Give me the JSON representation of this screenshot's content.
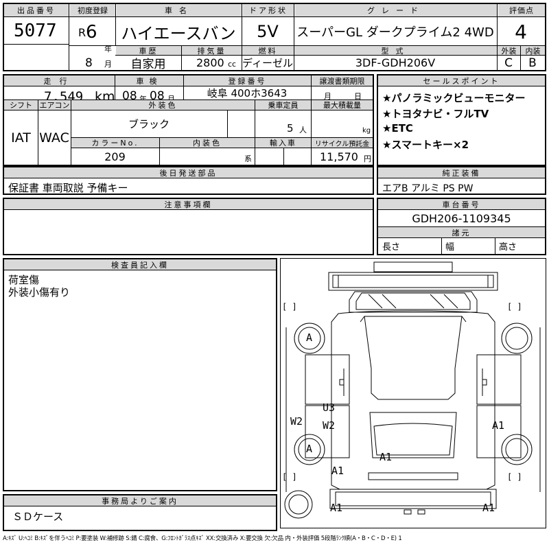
{
  "header": {
    "lot_label": "出品番号",
    "lot": "5077",
    "first_reg_label": "初度登録",
    "era": "R",
    "year": "6",
    "year_unit": "年",
    "month": "8",
    "month_unit": "月",
    "name_label": "車名",
    "name": "ハイエースバン",
    "door_label": "ドア形状",
    "door": "5V",
    "grade_label": "グレード",
    "grade": "スーパーGL ダークプライム2 4WD",
    "score_label": "評価点",
    "score": "4",
    "history_label": "車歴",
    "history": "自家用",
    "disp_label": "排気量",
    "disp": "2800",
    "disp_unit": "cc",
    "fuel_label": "燃料",
    "fuel": "ディーゼル",
    "model_label": "型式",
    "model": "3DF-GDH206V",
    "ext_label": "外装",
    "ext": "C",
    "int_label": "内装",
    "int": "B"
  },
  "details": {
    "mileage_label": "走行",
    "mileage": "7,549",
    "mileage_unit": "km",
    "inspect_label": "車検",
    "inspect_y": "08",
    "inspect_y_unit": "年",
    "inspect_m": "08",
    "inspect_m_unit": "月",
    "reg_label": "登録番号",
    "reg": "岐阜 400ホ3643",
    "transfer_label": "譲渡書類期限",
    "transfer_m_unit": "月",
    "transfer_d_unit": "日",
    "shift_label": "シフト",
    "shift": "IAT",
    "ac_label": "エアコン",
    "ac": "WAC",
    "color_label": "外装色",
    "color": "ブラック",
    "seats_label": "乗車定員",
    "seats": "5",
    "seats_unit": "人",
    "load_label": "最大積載量",
    "load_unit": "kg",
    "colorno_label": "カラーNo.",
    "colorno": "209",
    "intcolor_label": "内装色",
    "intcolor_unit": "系",
    "import_label": "輸入車",
    "recycle_label": "リサイクル預託金",
    "recycle": "11,570",
    "recycle_unit": "円"
  },
  "sales": {
    "label": "セールスポイント",
    "items": [
      "★パノラミックビューモニター",
      "★トヨタナビ・フルTV",
      "★ETC",
      "★スマートキー×2"
    ]
  },
  "later_parts": {
    "label": "後日発送部品",
    "value": "保証書 車両取説 予備キー"
  },
  "equipment": {
    "label": "純正装備",
    "value": "エアB アルミ PS PW"
  },
  "caution": {
    "label": "注意事項欄"
  },
  "chassis": {
    "label": "車台番号",
    "value": "GDH206-1109345"
  },
  "specs": {
    "label": "諸元",
    "length_label": "長さ",
    "width_label": "幅",
    "height_label": "高さ"
  },
  "inspector": {
    "label": "検査員記入欄",
    "lines": [
      "荷室傷",
      "外装小傷有り"
    ]
  },
  "office": {
    "label": "事務局よりご案内",
    "value": "ＳＤケース"
  },
  "diagram": {
    "bracket": "[   ]",
    "marks": {
      "wheel_fl": "A",
      "wheel_rl": "A",
      "u3": "U3",
      "w2_left": "W2",
      "w2_side": "W2",
      "a1_right": "A1",
      "a1_rear": "A1",
      "a1_bottom_left": "A1",
      "a1_left_lower": "A1",
      "a1_right_lower": "A1"
    }
  },
  "legend": "A:ｷｽﾞ U:ﾍｺﾐ B:ｷｽﾞを伴うﾍｺﾐ P:要塗装 W:補修跡 S:錆 C:腐食、G:ﾌﾛﾝﾄｶﾞﾗｽ点ｷｽﾞ XX:交換済み X:要交換 欠:欠品 内・外装評価 5段階ﾗﾝｸ順(A・B・C・D・E) 1"
}
